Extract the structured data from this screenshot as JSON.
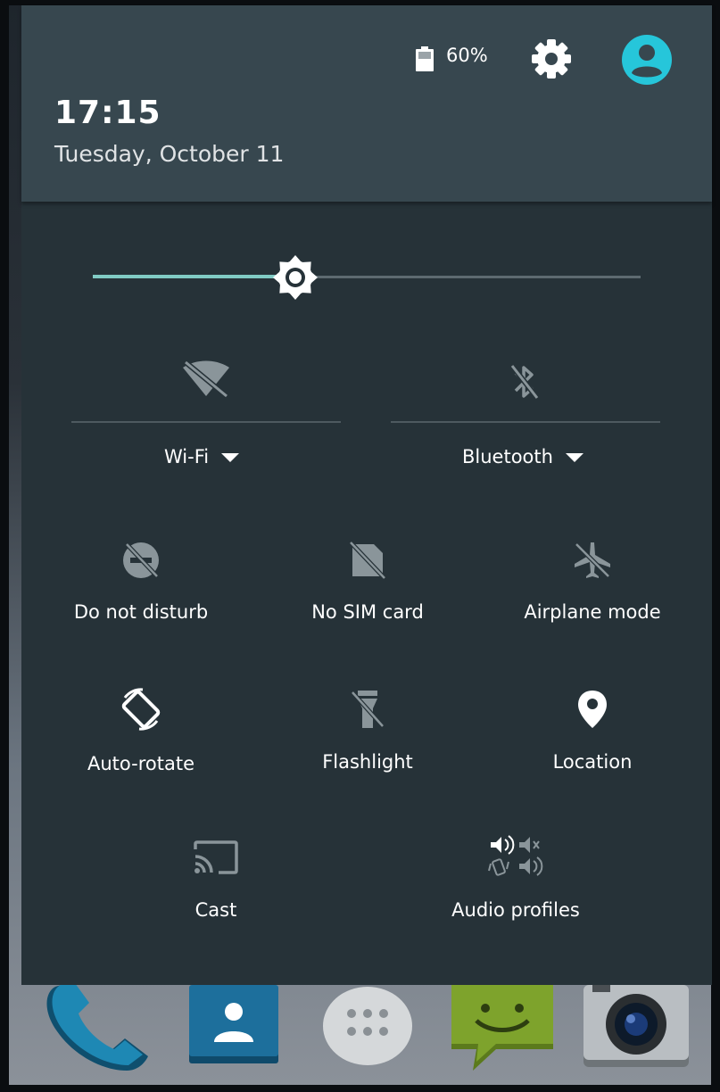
{
  "status": {
    "battery_level": "60%",
    "battery_icon": "battery-icon",
    "settings_icon": "gear-icon",
    "user_icon": "avatar-icon"
  },
  "header": {
    "time": "17:15",
    "date": "Tuesday, October 11"
  },
  "brightness": {
    "level": 0.37,
    "icon": "brightness-icon"
  },
  "tiles_top": [
    {
      "label": "Wi-Fi",
      "icon": "wifi-off-icon"
    },
    {
      "label": "Bluetooth",
      "icon": "bluetooth-off-icon"
    }
  ],
  "tiles": [
    {
      "label": "Do not disturb",
      "icon": "do-not-disturb-icon"
    },
    {
      "label": "No SIM card",
      "icon": "no-sim-icon"
    },
    {
      "label": "Airplane mode",
      "icon": "airplane-icon"
    },
    {
      "label": "Auto-rotate",
      "icon": "auto-rotate-icon"
    },
    {
      "label": "Flashlight",
      "icon": "flashlight-icon"
    },
    {
      "label": "Location",
      "icon": "location-icon"
    },
    {
      "label": "Cast",
      "icon": "cast-icon"
    },
    {
      "label": "Audio profiles",
      "icon": "audio-profiles-icon"
    }
  ],
  "dock": [
    {
      "icon": "phone-icon"
    },
    {
      "icon": "contacts-icon"
    },
    {
      "icon": "app-drawer-icon"
    },
    {
      "icon": "messaging-icon"
    },
    {
      "icon": "camera-icon"
    }
  ],
  "colors": {
    "panel": "#263238",
    "header": "#37474f",
    "accent": "#80cbc4",
    "avatar": "#26c6da",
    "inactive_icon": "#8a959a"
  }
}
